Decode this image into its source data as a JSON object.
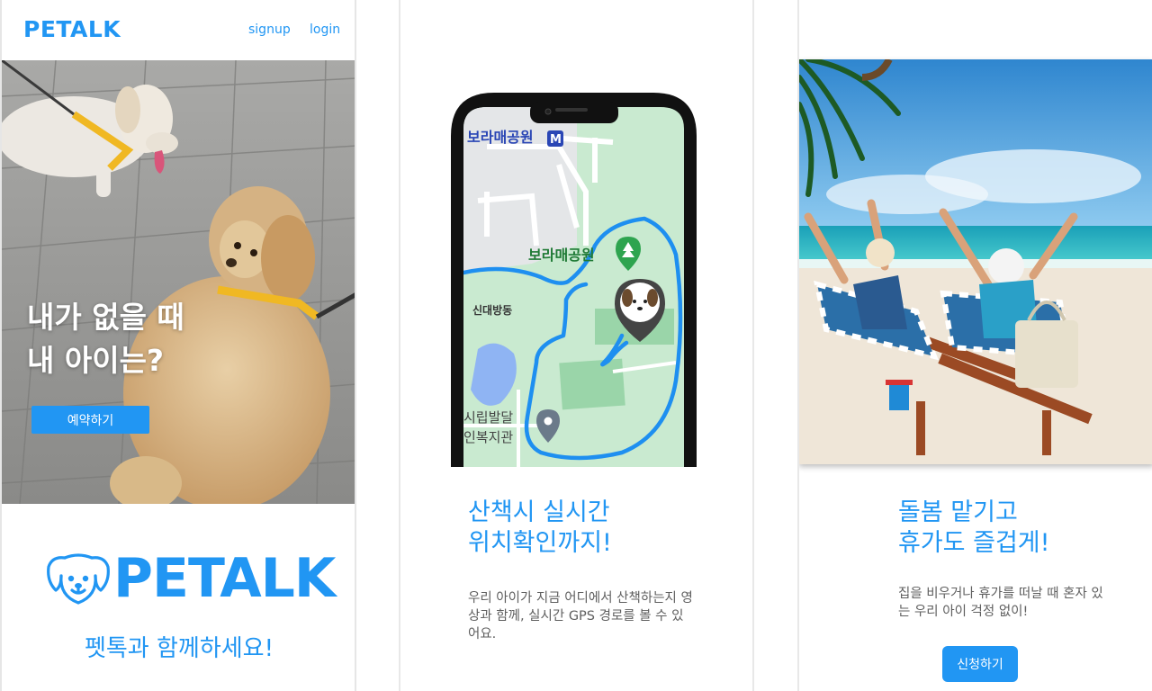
{
  "colors": {
    "accent": "#2196f3",
    "text_muted": "#5f5f5f"
  },
  "header": {
    "brand": "PETALK",
    "signup_label": "signup",
    "login_label": "login"
  },
  "hero": {
    "line1": "내가 없을 때",
    "line2": "내 아이는?",
    "button_label": "예약하기",
    "image": "two-dachshunds-on-leash-photo"
  },
  "brand_block": {
    "logo_icon": "dog-face-icon",
    "logo_text": "PETALK",
    "tagline": "펫톡과 함께하세요!"
  },
  "feature_gps": {
    "title_line1": "산책시 실시간",
    "title_line2": "위치확인까지!",
    "description": "우리 아이가 지금 어디에서 산책하는지 영상과 함께, 실시간 GPS 경로를 볼 수 있어요.",
    "map": {
      "label_station": "보라매공원",
      "station_badge": "M",
      "label_park": "보라매공원",
      "label_district": "신대방동",
      "label_poi_line1": "시립발달",
      "label_poi_line2": "인복지관"
    }
  },
  "feature_care": {
    "title_line1": "돌봄 맡기고",
    "title_line2": "휴가도 즐겁게!",
    "description": "집을 비우거나 휴가를 떠날 때 혼자 있는 우리 아이 걱정 없이!",
    "button_label": "신청하기",
    "image": "beach-vacation-photo"
  }
}
